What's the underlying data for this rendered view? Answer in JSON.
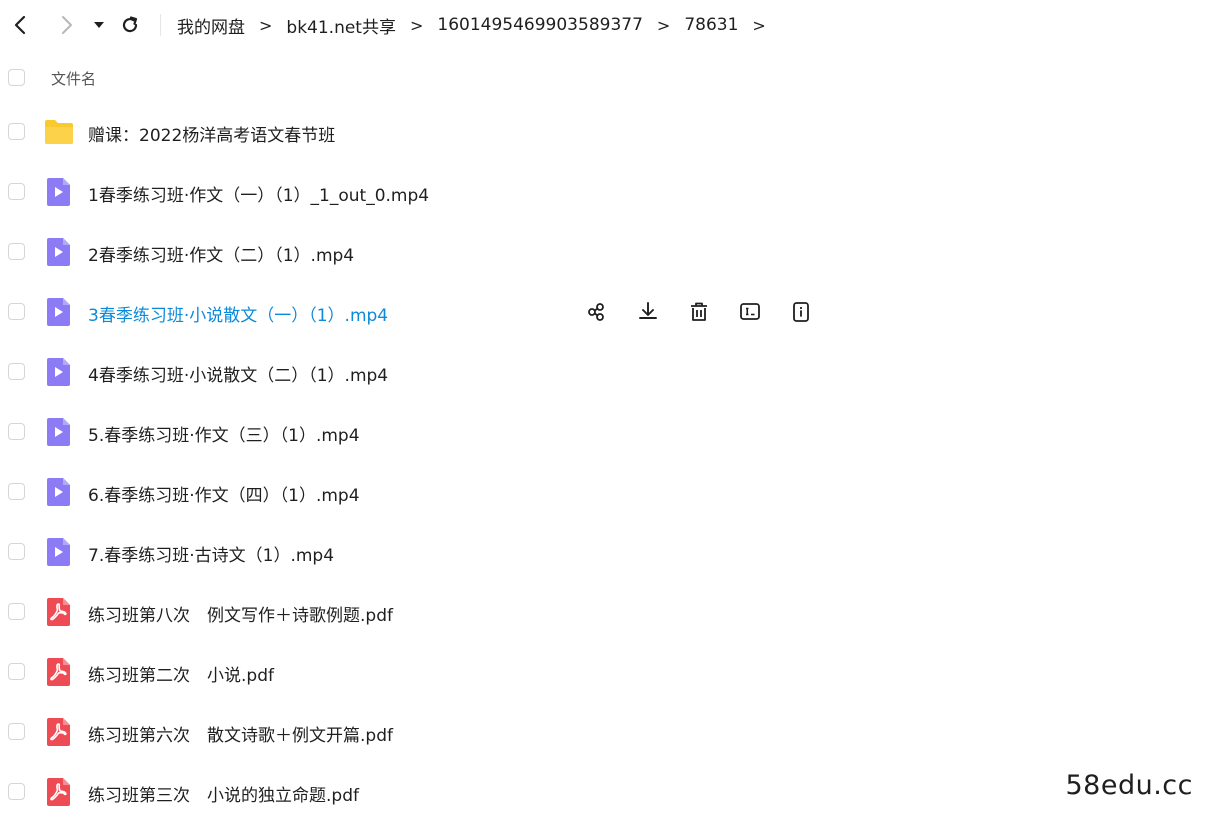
{
  "nav": {
    "back_icon": "chevron-left-icon",
    "forward_icon": "chevron-right-icon",
    "dropdown_icon": "caret-down-icon",
    "refresh_icon": "refresh-icon"
  },
  "breadcrumb": {
    "items": [
      "我的网盘",
      "bk41.net共享",
      "1601495469903589377",
      "78631"
    ],
    "separator": ">"
  },
  "list_header": {
    "name_label": "文件名"
  },
  "files": [
    {
      "name": "赠课：2022杨洋高考语文春节班",
      "type": "folder"
    },
    {
      "name": "1春季练习班·作文（一）（1）_1_out_0.mp4",
      "type": "video"
    },
    {
      "name": "2春季练习班·作文（二）（1）.mp4",
      "type": "video"
    },
    {
      "name": "3春季练习班·小说散文（一）（1）.mp4",
      "type": "video",
      "hovered": true
    },
    {
      "name": "4春季练习班·小说散文（二）（1）.mp4",
      "type": "video"
    },
    {
      "name": "5.春季练习班·作文（三）（1）.mp4",
      "type": "video"
    },
    {
      "name": "6.春季练习班·作文（四）（1）.mp4",
      "type": "video"
    },
    {
      "name": "7.春季练习班·古诗文（1）.mp4",
      "type": "video"
    },
    {
      "name": "练习班第八次　例文写作＋诗歌例题.pdf",
      "type": "pdf"
    },
    {
      "name": "练习班第二次　小说.pdf",
      "type": "pdf"
    },
    {
      "name": "练习班第六次　散文诗歌＋例文开篇.pdf",
      "type": "pdf"
    },
    {
      "name": "练习班第三次　小说的独立命题.pdf",
      "type": "pdf"
    }
  ],
  "row_actions": [
    "share-icon",
    "download-icon",
    "delete-icon",
    "rename-icon",
    "details-icon"
  ],
  "colors": {
    "folder": "#f9c930",
    "video": "#8b7cf6",
    "pdf": "#ef4b54",
    "hover_text": "#0b8ad9"
  },
  "watermark": "58edu.cc"
}
